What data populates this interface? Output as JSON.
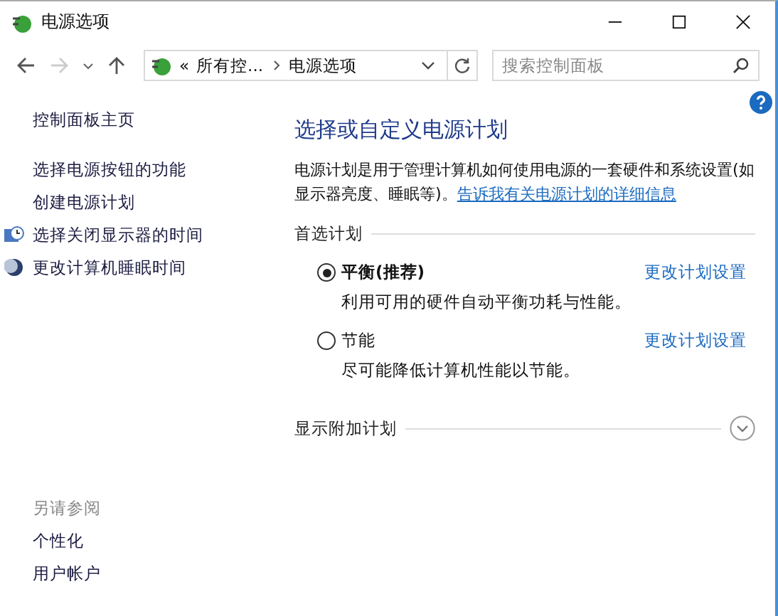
{
  "window": {
    "title": "电源选项"
  },
  "nav": {
    "back": {
      "disabled": false
    },
    "forward": {
      "disabled": true
    }
  },
  "address": {
    "overflow": "«",
    "crumbs": [
      "所有控...",
      "电源选项"
    ]
  },
  "search": {
    "placeholder": "搜索控制面板"
  },
  "sidebar": {
    "items": [
      {
        "label": "控制面板主页",
        "kind": "plain"
      },
      {
        "label": "选择电源按钮的功能",
        "kind": "plain"
      },
      {
        "label": "创建电源计划",
        "kind": "plain"
      },
      {
        "label": "选择关闭显示器的时间",
        "kind": "display"
      },
      {
        "label": "更改计算机睡眠时间",
        "kind": "sleep"
      }
    ],
    "see_also": {
      "heading": "另请参阅",
      "items": [
        "个性化",
        "用户帐户"
      ]
    }
  },
  "main": {
    "title": "选择或自定义电源计划",
    "description": "电源计划是用于管理计算机如何使用电源的一套硬件和系统设置(如显示器亮度、睡眠等)。",
    "link": "告诉我有关电源计划的详细信息",
    "section": "首选计划",
    "plans": [
      {
        "name": "平衡",
        "note": "(推荐)",
        "selected": true,
        "description": "利用可用的硬件自动平衡功耗与性能。",
        "action": "更改计划设置"
      },
      {
        "name": "节能",
        "selected": false,
        "description": "尽可能降低计算机性能以节能。",
        "action": "更改计划设置"
      }
    ],
    "more": "显示附加计划"
  }
}
